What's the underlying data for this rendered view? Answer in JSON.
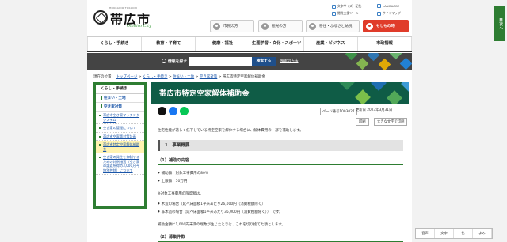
{
  "header": {
    "logo_sub": "HOKKAIDO TOKACHI",
    "city_name": "帯広市",
    "tagline": "Obihiro City",
    "personas": [
      {
        "label": "市民の方",
        "icon": "person-icon"
      },
      {
        "label": "観光の方",
        "icon": "headphones-icon"
      },
      {
        "label": "移住・ふるさと納税",
        "icon": "house-icon"
      },
      {
        "label": "もしもの時",
        "icon": "alert-icon"
      }
    ],
    "utility_links": [
      "文字サイズ・配色",
      "閲覧支援ツール",
      "LANGUAGE",
      "サイトマップ"
    ]
  },
  "gnav": [
    "くらし・手続き",
    "教育・子育て",
    "健康・福祉",
    "生涯学習・文化・スポーツ",
    "産業・ビジネス",
    "市政情報"
  ],
  "search": {
    "label": "情報を探す",
    "placeholder": "",
    "button": "検索する",
    "help_link": "検索の方法"
  },
  "breadcrumb": {
    "prefix": "現在の位置：",
    "items": [
      "トップページ",
      "くらし・手続き",
      "住まい・土地",
      "空き家対策"
    ],
    "current": "帯広市特定空家解体補助金"
  },
  "sidebar": {
    "heading": "くらし・手続き",
    "category1": "住まい・土地",
    "category2": "空き家対策",
    "items": [
      "帯広市空き家マッチングシステム",
      "空き家の管理について",
      "帯広市空家等対策計画",
      "帯広市特定空家解体補助金",
      "空き家の発生を抑制するための特例措置（空き家の譲渡所得の3,000万円特別控除）について"
    ],
    "active_index": 3
  },
  "main": {
    "title": "帯広市特定空家解体補助金",
    "page_id": "ページ番号1003027",
    "updated": "更新日 2023年3月31日",
    "print": "印刷",
    "print_large": "大きな文字で印刷",
    "intro": "住宅性能が著しく低下している特定空家を解体する場合に、解体費用の一部を補助します。",
    "section1": "1　事業概要",
    "sub1": "（1）補助の内容",
    "lines": [
      "補助額：対象工事費用の80%",
      "上限額：50万円",
      "※対象工事費用の限度額は、",
      "木造の場合（延べ床面積1平米あたり26,000円（消費税額除く）",
      "非木造の場合（延べ床面積1平米あたり35,000円（消費税額除く））　です。",
      "補助金額に1,000円未満の端数が生じたときは、これを切り捨てた額とします。"
    ],
    "sub2": "（2）募集件数"
  },
  "floating_tools": [
    "音声",
    "文字",
    "色",
    "よみ"
  ],
  "side_tab": "目次へ"
}
